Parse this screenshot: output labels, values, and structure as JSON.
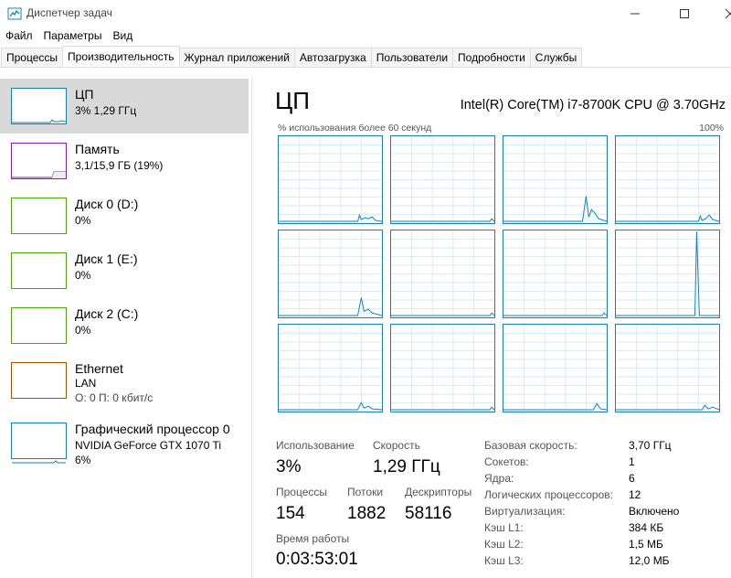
{
  "window": {
    "title": "Диспетчер задач"
  },
  "menu": [
    "Файл",
    "Параметры",
    "Вид"
  ],
  "tabs": [
    {
      "label": "Процессы",
      "active": false
    },
    {
      "label": "Производительность",
      "active": true
    },
    {
      "label": "Журнал приложений",
      "active": false
    },
    {
      "label": "Автозагрузка",
      "active": false
    },
    {
      "label": "Пользователи",
      "active": false
    },
    {
      "label": "Подробности",
      "active": false
    },
    {
      "label": "Службы",
      "active": false
    }
  ],
  "sidebar": {
    "items": [
      {
        "name": "ЦП",
        "lines": [
          "3%  1,29 ГГц"
        ],
        "color": "#1780b7"
      },
      {
        "name": "Память",
        "lines": [
          "3,1/15,9 ГБ (19%)"
        ],
        "color": "#8b1eb0"
      },
      {
        "name": "Диск 0 (D:)",
        "lines": [
          "0%"
        ],
        "color": "#4da60c"
      },
      {
        "name": "Диск 1 (E:)",
        "lines": [
          "0%"
        ],
        "color": "#4da60c"
      },
      {
        "name": "Диск 2 (C:)",
        "lines": [
          "0%"
        ],
        "color": "#4da60c"
      },
      {
        "name": "Ethernet",
        "lines": [
          "LAN",
          "О: 0  П: 0 кбит/с"
        ],
        "color": "#a74f01"
      },
      {
        "name": "Графический процессор 0",
        "lines": [
          "NVIDIA GeForce GTX 1070 Ti",
          "6%"
        ],
        "color": "#1780b7"
      }
    ]
  },
  "main": {
    "title": "ЦП",
    "cpu_model": "Intel(R) Core(TM) i7-8700K CPU @ 3.70GHz",
    "graph_label": "% использования более 60 секунд",
    "graph_max": "100%",
    "stats": {
      "usage_label": "Использование",
      "usage_value": "3%",
      "speed_label": "Скорость",
      "speed_value": "1,29 ГГц",
      "processes_label": "Процессы",
      "processes_value": "154",
      "threads_label": "Потоки",
      "threads_value": "1882",
      "handles_label": "Дескрипторы",
      "handles_value": "58116",
      "uptime_label": "Время работы",
      "uptime_value": "0:03:53:01"
    },
    "specs": [
      {
        "label": "Базовая скорость:",
        "value": "3,70 ГГц"
      },
      {
        "label": "Сокетов:",
        "value": "1"
      },
      {
        "label": "Ядра:",
        "value": "6"
      },
      {
        "label": "Логических процессоров:",
        "value": "12"
      },
      {
        "label": "Виртуализация:",
        "value": "Включено"
      },
      {
        "label": "Кэш L1:",
        "value": "384 КБ"
      },
      {
        "label": "Кэш L2:",
        "value": "1,5 МБ"
      },
      {
        "label": "Кэш L3:",
        "value": "12,0 МБ"
      }
    ]
  }
}
